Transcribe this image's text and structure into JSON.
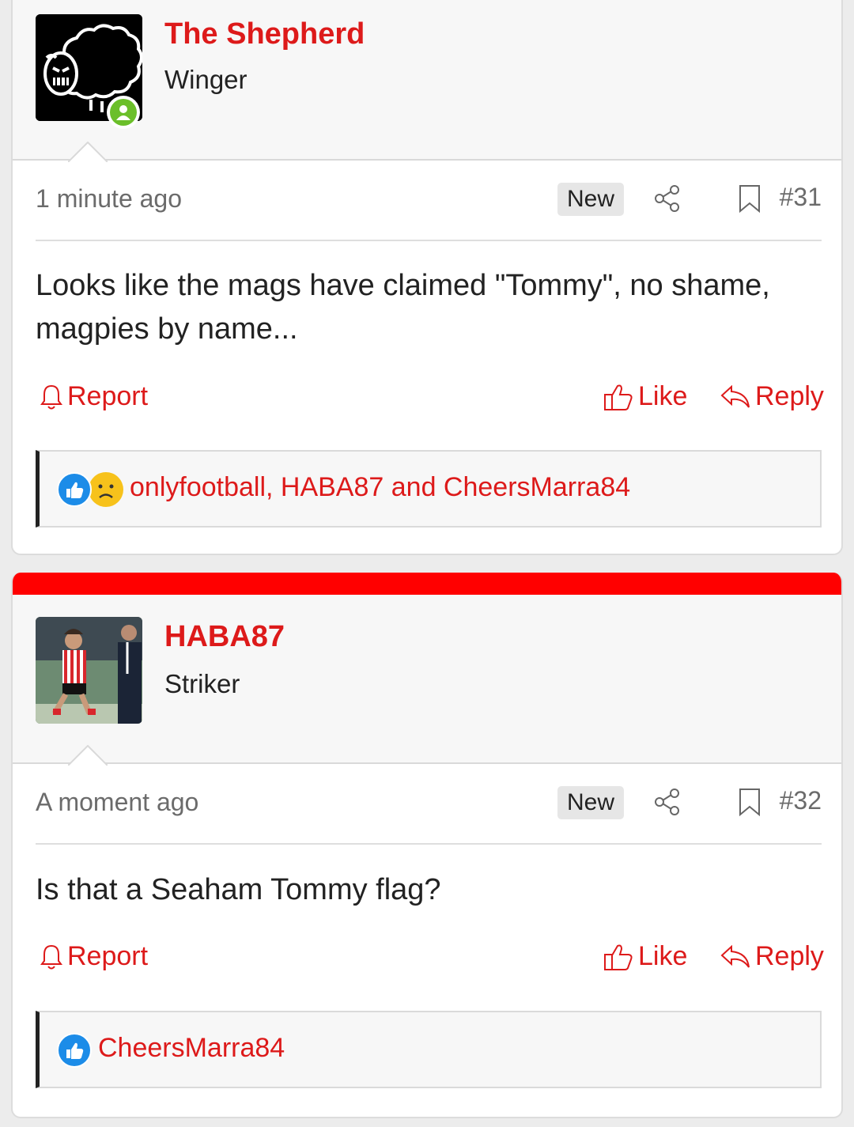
{
  "posts": [
    {
      "username": "The Shepherd",
      "user_title": "Winger",
      "online": true,
      "avatar": "black-sheep-avatar",
      "time": "1 minute ago",
      "badge": "New",
      "post_number": "#31",
      "content": "Looks like the mags have claimed \"Tommy\", no shame, magpies by name...",
      "actions": {
        "report": "Report",
        "like": "Like",
        "reply": "Reply"
      },
      "reactions": {
        "icons": [
          "like-reaction-icon",
          "sad-reaction-icon"
        ],
        "users": "onlyfootball, HABA87 and CheersMarra84"
      }
    },
    {
      "username": "HABA87",
      "user_title": "Striker",
      "online": false,
      "avatar": "football-player-photo-avatar",
      "time": "A moment ago",
      "badge": "New",
      "post_number": "#32",
      "content": "Is that a Seaham Tommy flag?",
      "actions": {
        "report": "Report",
        "like": "Like",
        "reply": "Reply"
      },
      "reactions": {
        "icons": [
          "like-reaction-icon"
        ],
        "users": "CheersMarra84"
      }
    }
  ],
  "colors": {
    "accent": "#dd1a1a",
    "separator_bar": "#ff0000",
    "online": "#6bbf2a",
    "like_reaction": "#1c8ce8",
    "sad_reaction": "#f7c21b"
  }
}
